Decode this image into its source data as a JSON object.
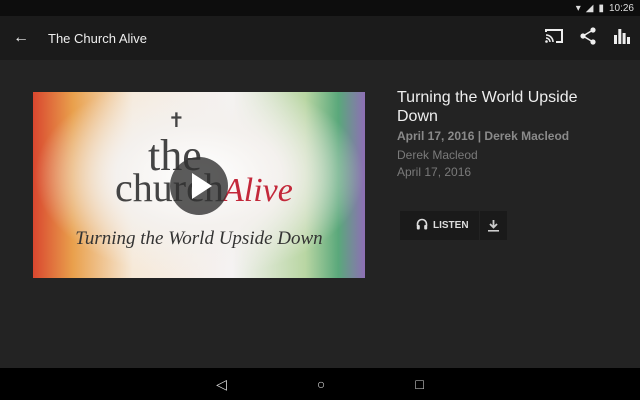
{
  "status": {
    "time": "10:26",
    "icons": [
      "wifi-icon",
      "signal-icon",
      "battery-icon"
    ]
  },
  "appbar": {
    "title": "The Church Alive",
    "icons": [
      "back-arrow-icon",
      "cast-icon",
      "share-icon",
      "stats-icon"
    ]
  },
  "thumbnail": {
    "logo_text": [
      "the",
      "church",
      "Alive"
    ],
    "subtitle": "Turning the World Upside Down"
  },
  "sermon": {
    "title": "Turning the World Upside Down",
    "subtitle": "April 17, 2016 | Derek Macleod",
    "speaker": "Derek Macleod",
    "date": "April 17, 2016",
    "listen_label": "LISTEN"
  },
  "colors": {
    "accent": "#c3283a",
    "background": "#232323"
  }
}
